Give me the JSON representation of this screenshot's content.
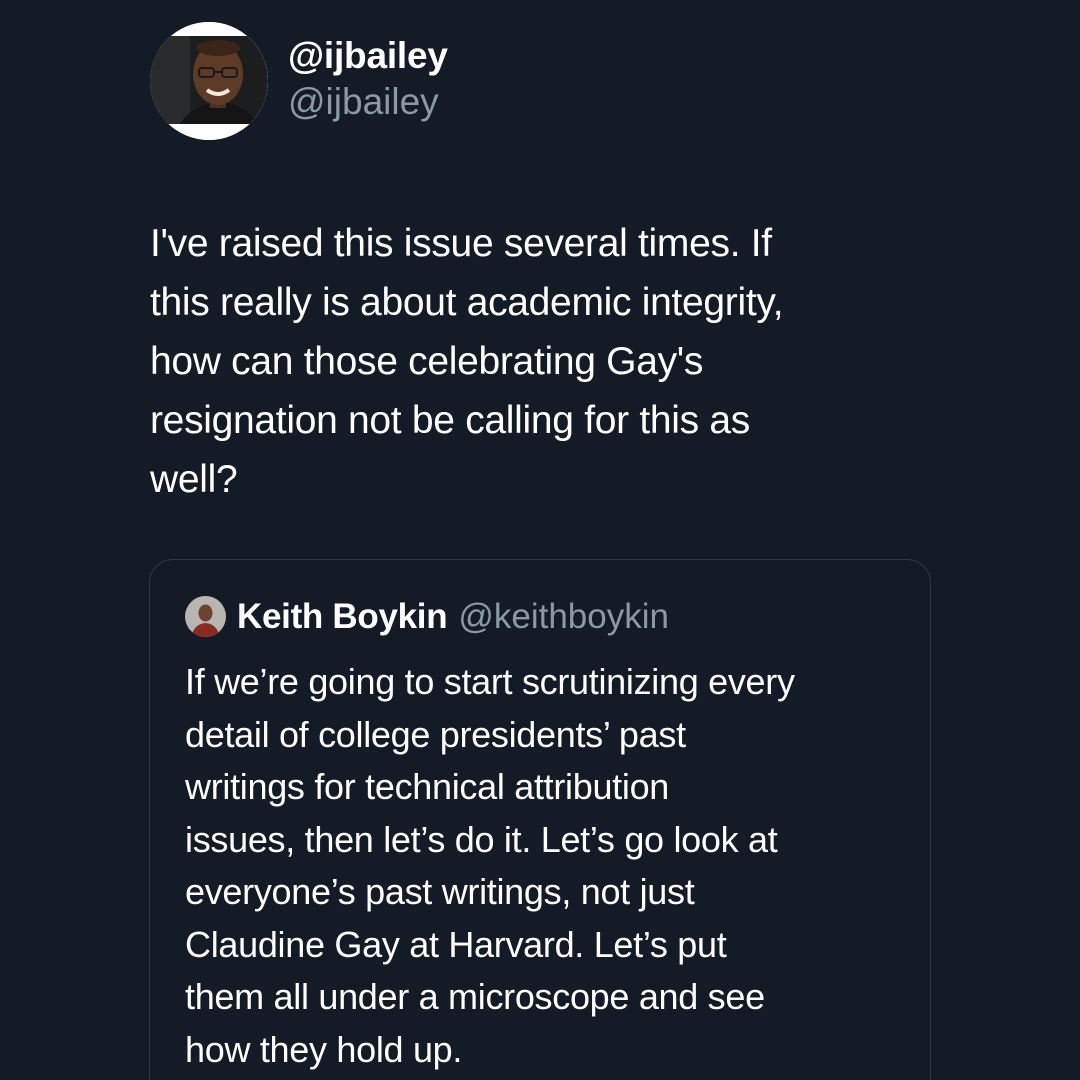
{
  "author": {
    "display_name": "@ijbailey",
    "handle": "@ijbailey",
    "avatar_icon": "profile-photo-avatar"
  },
  "tweet": {
    "text": "I've raised this issue several times. If\nthis really is about academic integrity,\nhow can those celebrating Gay's\nresignation not be calling for this as\nwell?"
  },
  "quoted_tweet": {
    "display_name": "Keith Boykin",
    "handle": "@keithboykin",
    "avatar_icon": "profile-photo-avatar",
    "text": "If we’re going to start scrutinizing every\ndetail of college presidents’ past\nwritings for technical attribution\nissues, then let’s do it. Let’s go look at\neveryone’s past writings, not just\nClaudine Gay at Harvard. Let’s put\nthem all under a microscope and see\nhow they hold up."
  },
  "colors": {
    "background": "#151b26",
    "primary_text": "#ffffff",
    "secondary_text": "#8b98a5",
    "card_border": "#2f3743"
  }
}
